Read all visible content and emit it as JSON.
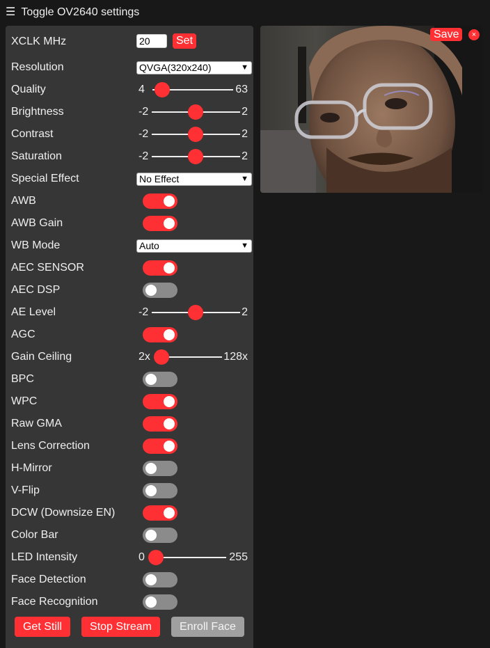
{
  "header": {
    "title": "Toggle OV2640 settings",
    "menu_icon": "☰"
  },
  "xclk": {
    "label": "XCLK MHz",
    "value": "20",
    "set_label": "Set"
  },
  "resolution": {
    "label": "Resolution",
    "selected": "QVGA(320x240)"
  },
  "quality": {
    "label": "Quality",
    "min": "4",
    "max": "63",
    "value": 10
  },
  "brightness": {
    "label": "Brightness",
    "min": "-2",
    "max": "2",
    "value": 0
  },
  "contrast": {
    "label": "Contrast",
    "min": "-2",
    "max": "2",
    "value": 0
  },
  "saturation": {
    "label": "Saturation",
    "min": "-2",
    "max": "2",
    "value": 0
  },
  "special_effect": {
    "label": "Special Effect",
    "selected": "No Effect"
  },
  "awb": {
    "label": "AWB",
    "on": true
  },
  "awb_gain": {
    "label": "AWB Gain",
    "on": true
  },
  "wb_mode": {
    "label": "WB Mode",
    "selected": "Auto"
  },
  "aec_sensor": {
    "label": "AEC SENSOR",
    "on": true
  },
  "aec_dsp": {
    "label": "AEC DSP",
    "on": false
  },
  "ae_level": {
    "label": "AE Level",
    "min": "-2",
    "max": "2",
    "value": 0
  },
  "agc": {
    "label": "AGC",
    "on": true
  },
  "gain_ceiling": {
    "label": "Gain Ceiling",
    "min": "2x",
    "max": "128x",
    "value": 0
  },
  "bpc": {
    "label": "BPC",
    "on": false
  },
  "wpc": {
    "label": "WPC",
    "on": true
  },
  "raw_gma": {
    "label": "Raw GMA",
    "on": true
  },
  "lens_correction": {
    "label": "Lens Correction",
    "on": true
  },
  "h_mirror": {
    "label": "H-Mirror",
    "on": false
  },
  "v_flip": {
    "label": "V-Flip",
    "on": false
  },
  "dcw": {
    "label": "DCW (Downsize EN)",
    "on": true
  },
  "color_bar": {
    "label": "Color Bar",
    "on": false
  },
  "led_intensity": {
    "label": "LED Intensity",
    "min": "0",
    "max": "255",
    "value": 0
  },
  "face_detection": {
    "label": "Face Detection",
    "on": false
  },
  "face_recognition": {
    "label": "Face Recognition",
    "on": false
  },
  "buttons": {
    "get_still": "Get Still",
    "stop_stream": "Stop Stream",
    "enroll_face": "Enroll Face"
  },
  "stream": {
    "save_label": "Save",
    "close_label": "×"
  },
  "colors": {
    "accent": "#ff3034",
    "panel": "#363636",
    "background": "#181818",
    "switch_off": "#8b8b8b"
  }
}
